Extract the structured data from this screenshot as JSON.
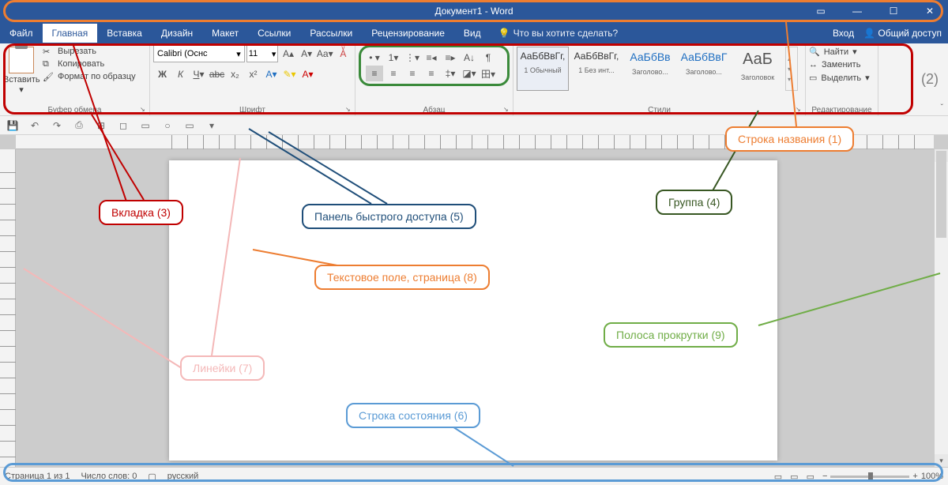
{
  "title": "Документ1 - Word",
  "menus": {
    "file": "Файл",
    "home": "Главная",
    "insert": "Вставка",
    "design": "Дизайн",
    "layout": "Макет",
    "links": "Ссылки",
    "mailings": "Рассылки",
    "review": "Рецензирование",
    "view": "Вид",
    "tell": "Что вы хотите сделать?",
    "signin": "Вход",
    "share": "Общий доступ"
  },
  "ribbon": {
    "clipboard": {
      "label": "Буфер обмена",
      "paste": "Вставить",
      "cut": "Вырезать",
      "copy": "Копировать",
      "painter": "Формат по образцу"
    },
    "font": {
      "label": "Шрифт",
      "name": "Calibri (Оснс",
      "size": "11"
    },
    "paragraph": {
      "label": "Абзац"
    },
    "styles": {
      "label": "Стили",
      "items": [
        {
          "preview": "АаБбВвГг,",
          "name": "1 Обычный"
        },
        {
          "preview": "АаБбВвГг,",
          "name": "1 Без инт..."
        },
        {
          "preview": "АаБбВв",
          "name": "Заголово..."
        },
        {
          "preview": "АаБбВвГ",
          "name": "Заголово..."
        },
        {
          "preview": "АаБ",
          "name": "Заголовок"
        }
      ]
    },
    "editing": {
      "label": "Редактирование",
      "find": "Найти",
      "replace": "Заменить",
      "select": "Выделить"
    }
  },
  "status": {
    "page": "Страница 1 из 1",
    "words": "Число слов: 0",
    "lang": "русский",
    "zoom": "100%"
  },
  "annotations": {
    "a1": "Строка названия (1)",
    "a2": "(2)",
    "a3": "Вкладка (3)",
    "a4": "Группа (4)",
    "a5": "Панель быстрого доступа (5)",
    "a6": "Строка состояния (6)",
    "a7": "Линейки (7)",
    "a8": "Текстовое поле, страница (8)",
    "a9": "Полоса прокрутки (9)"
  }
}
